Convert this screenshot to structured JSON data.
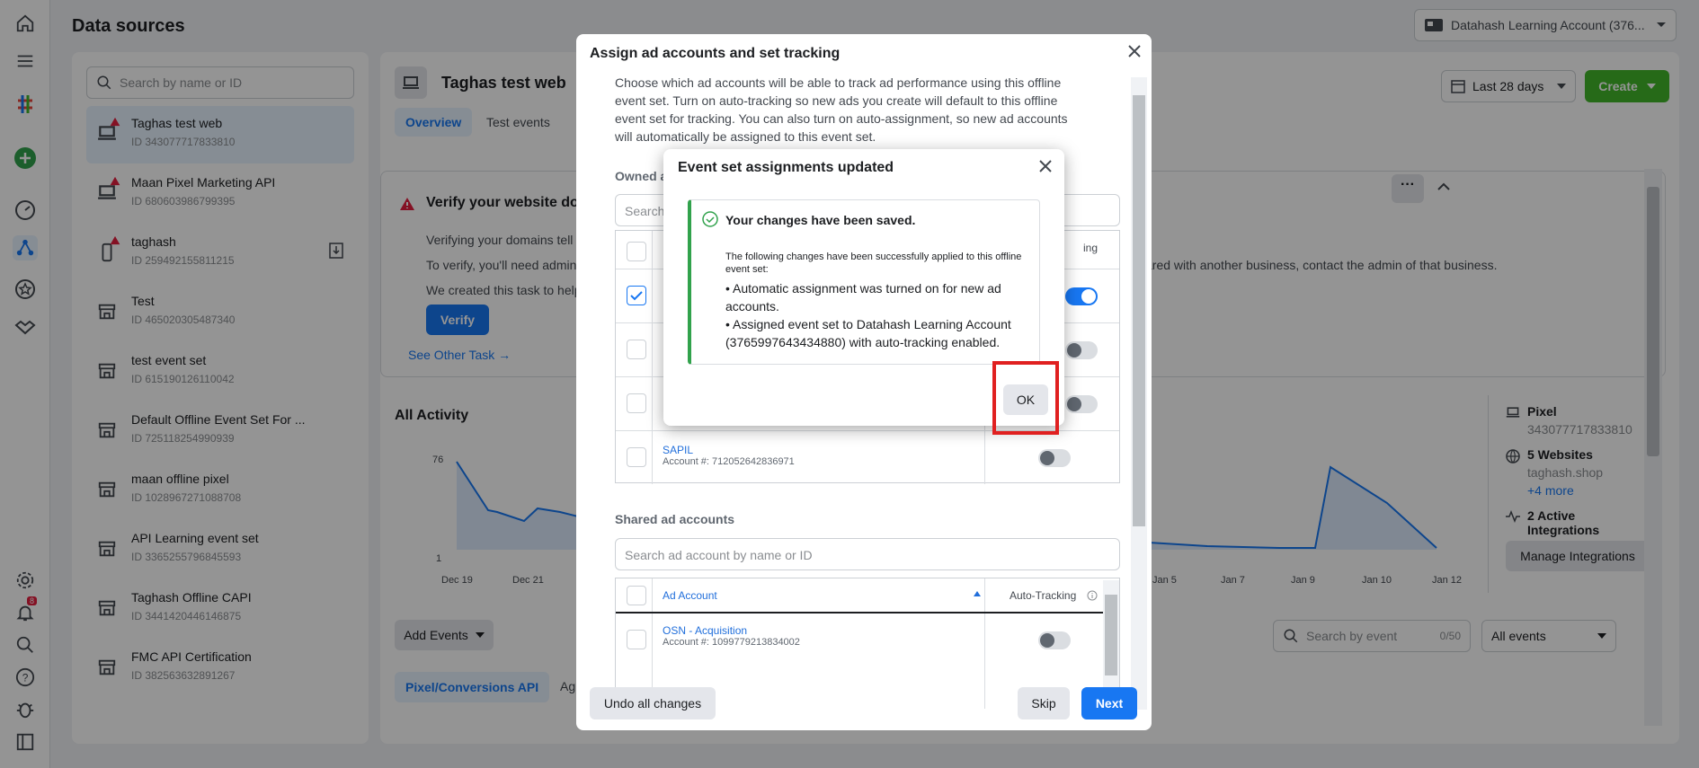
{
  "page": {
    "title": "Data sources"
  },
  "account_selector": {
    "label": "Datahash Learning Account (376..."
  },
  "sidebar": {
    "search_placeholder": "Search by name or ID",
    "items": [
      {
        "name": "Taghas test web",
        "id": "ID 343077717833810",
        "icon": "laptop-icon",
        "warning": true
      },
      {
        "name": "Maan Pixel Marketing API",
        "id": "ID 680603986799395",
        "icon": "laptop-icon",
        "warning": true
      },
      {
        "name": "taghash",
        "id": "ID 259492155811215",
        "icon": "phone-icon",
        "warning": true
      },
      {
        "name": "Test",
        "id": "ID 465020305487340",
        "icon": "store-icon",
        "warning": false
      },
      {
        "name": "test event set",
        "id": "ID 615190126110042",
        "icon": "store-icon",
        "warning": false
      },
      {
        "name": "Default Offline Event Set For ...",
        "id": "ID 725118254990939",
        "icon": "store-icon",
        "warning": false
      },
      {
        "name": "maan offline pixel",
        "id": "ID 1028967271088708",
        "icon": "store-icon",
        "warning": false
      },
      {
        "name": "API Learning event set",
        "id": "ID 3365255796845593",
        "icon": "store-icon",
        "warning": false
      },
      {
        "name": "Taghash Offline CAPI",
        "id": "ID 3441420446146875",
        "icon": "store-icon",
        "warning": false
      },
      {
        "name": "FMC API Certification",
        "id": "ID 382563632891267",
        "icon": "store-icon",
        "warning": false
      }
    ]
  },
  "main": {
    "source_title": "Taghas test web",
    "tabs": [
      "Overview",
      "Test events"
    ],
    "date_range": "Last 28 days",
    "create_label": "Create",
    "verify": {
      "title": "Verify your website dor",
      "line1": "Verifying your domains tell",
      "line2": "To verify, you'll need admin",
      "line2_tail": "ared with another business, contact the admin of that business.",
      "line3": "We created this task to help",
      "button": "Verify",
      "link": "See Other Task →"
    },
    "activity": {
      "title": "All Activity",
      "y_max": "76",
      "y_min": "1",
      "x_ticks_left": [
        "Dec 19",
        "Dec 21"
      ],
      "x_ticks_right": [
        "Jan 5",
        "Jan 7",
        "Jan 9",
        "Jan 10",
        "Jan 12"
      ]
    },
    "info": {
      "pixel_label": "Pixel",
      "pixel_id": "343077717833810",
      "websites": "5 Websites",
      "website_domain": "taghash.shop",
      "more": "+4 more",
      "integrations": "2 Active Integrations",
      "manage": "Manage Integrations"
    },
    "add_events": "Add Events",
    "event_search_placeholder": "Search by event",
    "event_count": "0/50",
    "all_events": "All events",
    "bottom_tab": "Pixel/Conversions API",
    "bottom_tab2": "Ag"
  },
  "dialog": {
    "title": "Assign ad accounts and set tracking",
    "description": "Choose which ad accounts will be able to track ad performance using this offline event set. Turn on auto-tracking so new ads you create will default to this offline event set for tracking. You can also turn on auto-assignment, so new ad accounts will automatically be assigned to this event set.",
    "owned_label": "Owned a",
    "owned_search": "Search",
    "owned_col_tail": "ing",
    "owned_rows": [
      {
        "name": "SAPIL",
        "account": "Account #: 712052642836971"
      }
    ],
    "shared_label": "Shared ad accounts",
    "shared_search_placeholder": "Search ad account by name or ID",
    "col_account": "Ad Account",
    "col_tracking": "Auto-Tracking",
    "shared_rows": [
      {
        "name": "OSN - Acquisition",
        "account": "Account #: 1099779213834002"
      }
    ],
    "undo": "Undo all changes",
    "skip": "Skip",
    "next": "Next"
  },
  "modal": {
    "title": "Event set assignments updated",
    "saved": "Your changes have been saved.",
    "intro": "The following changes have been successfully applied to this offline event set:",
    "bullets": [
      "• Automatic assignment was turned on for new ad accounts.",
      "• Assigned event set to Datahash Learning Account (3765997643434880) with auto-tracking enabled."
    ],
    "ok": "OK"
  },
  "notifications": {
    "badge": "8"
  },
  "colors": {
    "primary": "#1877f2",
    "create": "#42b72a",
    "success": "#31a24c",
    "highlight": "#e02020"
  }
}
